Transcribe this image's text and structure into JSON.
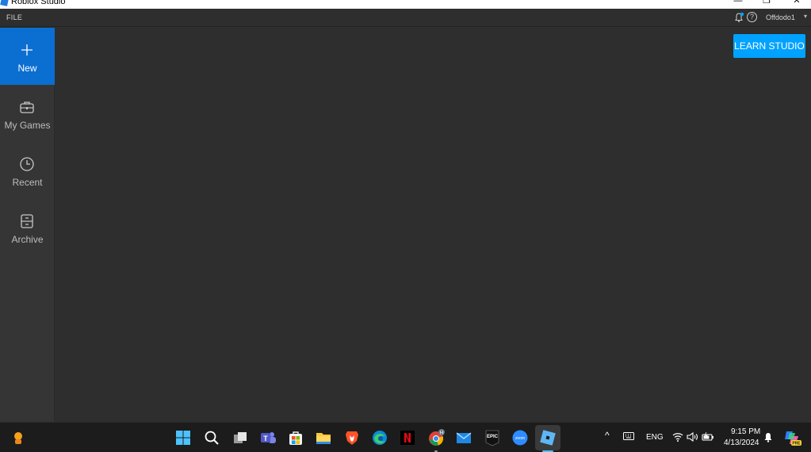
{
  "window": {
    "title": "Roblox Studio",
    "minimize": "—",
    "maximize": "❐",
    "close": "✕"
  },
  "menubar": {
    "file_label": "FILE",
    "username": "Offdodo1",
    "help_glyph": "?",
    "caret": "▾"
  },
  "sidebar": {
    "items": [
      {
        "label": "New",
        "icon": "plus-icon",
        "active": true
      },
      {
        "label": "My Games",
        "icon": "briefcase-icon",
        "active": false
      },
      {
        "label": "Recent",
        "icon": "clock-icon",
        "active": false
      },
      {
        "label": "Archive",
        "icon": "archive-box-icon",
        "active": false
      }
    ]
  },
  "main": {
    "learn_button": "LEARN STUDIO"
  },
  "taskbar": {
    "apps": [
      "widgets",
      "start",
      "search",
      "task-view",
      "teams",
      "microsoft-store",
      "file-explorer",
      "brave",
      "edge",
      "netflix",
      "chrome",
      "mail",
      "epic-games",
      "zoom",
      "roblox-studio"
    ],
    "epic_label": "EPIC",
    "zoom_label": "zoom",
    "chrome_badge": "H",
    "tray": {
      "chevron": "^",
      "language": "ENG",
      "time": "9:15 PM",
      "date": "4/13/2024",
      "copilot_badge": "PRE"
    }
  },
  "colors": {
    "accent_blue": "#00a2ff",
    "active_nav": "#0b6ed1",
    "background": "#2e2e2e",
    "sidebar": "#353535"
  }
}
